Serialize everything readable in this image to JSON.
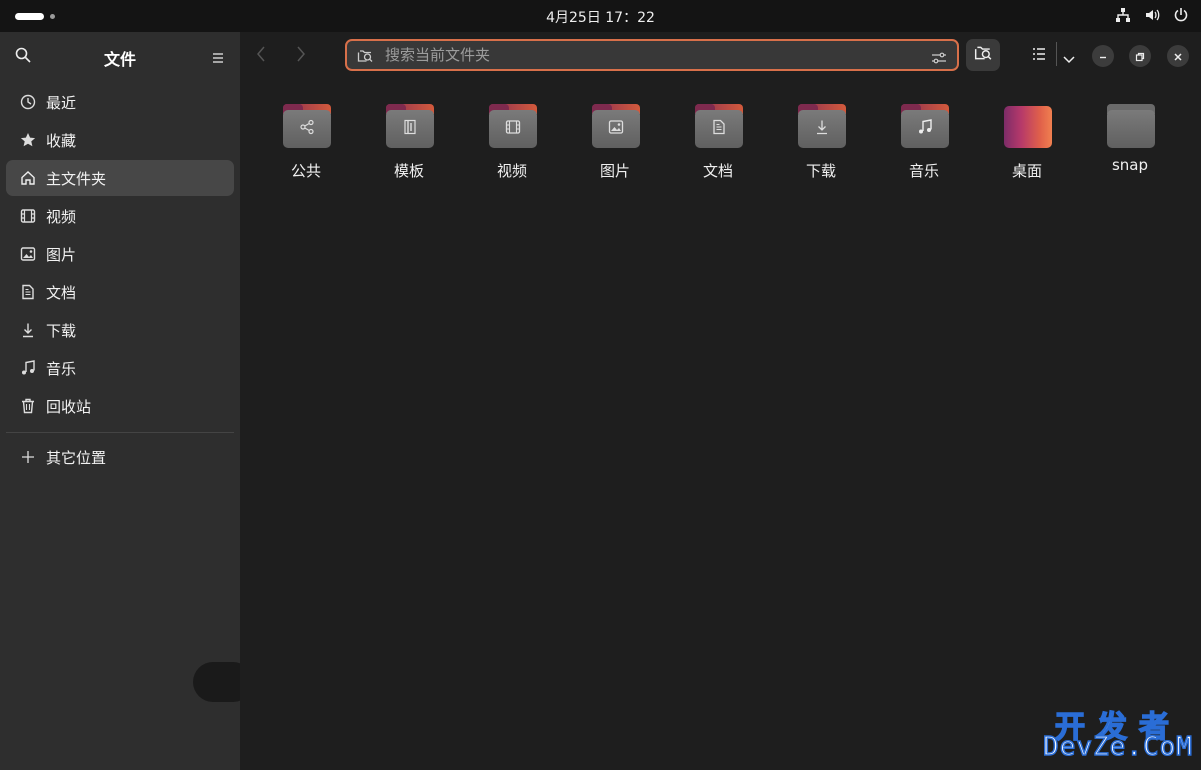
{
  "topbar": {
    "clock": "4月25日  17：22"
  },
  "sidebar": {
    "title": "文件",
    "items": [
      {
        "label": "最近",
        "icon": "clock-icon"
      },
      {
        "label": "收藏",
        "icon": "star-icon"
      },
      {
        "label": "主文件夹",
        "icon": "home-icon",
        "active": true
      },
      {
        "label": "视频",
        "icon": "film-icon"
      },
      {
        "label": "图片",
        "icon": "image-icon"
      },
      {
        "label": "文档",
        "icon": "document-icon"
      },
      {
        "label": "下载",
        "icon": "download-icon"
      },
      {
        "label": "音乐",
        "icon": "music-icon"
      },
      {
        "label": "回收站",
        "icon": "trash-icon"
      }
    ],
    "other": {
      "label": "其它位置",
      "icon": "plus-icon"
    }
  },
  "header": {
    "search_placeholder": "搜索当前文件夹",
    "search_value": ""
  },
  "folders": [
    {
      "name": "公共",
      "icon": "share-icon"
    },
    {
      "name": "模板",
      "icon": "template-icon"
    },
    {
      "name": "视频",
      "icon": "film-icon"
    },
    {
      "name": "图片",
      "icon": "image-icon"
    },
    {
      "name": "文档",
      "icon": "document-icon"
    },
    {
      "name": "下载",
      "icon": "download-icon"
    },
    {
      "name": "音乐",
      "icon": "music-icon"
    },
    {
      "name": "桌面",
      "icon": "desktop-folder"
    },
    {
      "name": "snap",
      "icon": "folder-icon"
    }
  ],
  "watermark": {
    "line1": "开发者",
    "line2": "DevZe.CoM"
  },
  "colors": {
    "accent": "#d8704a",
    "sidebar_bg": "#2e2e2e",
    "main_bg": "#1e1e1e",
    "active_item_bg": "#474747"
  }
}
